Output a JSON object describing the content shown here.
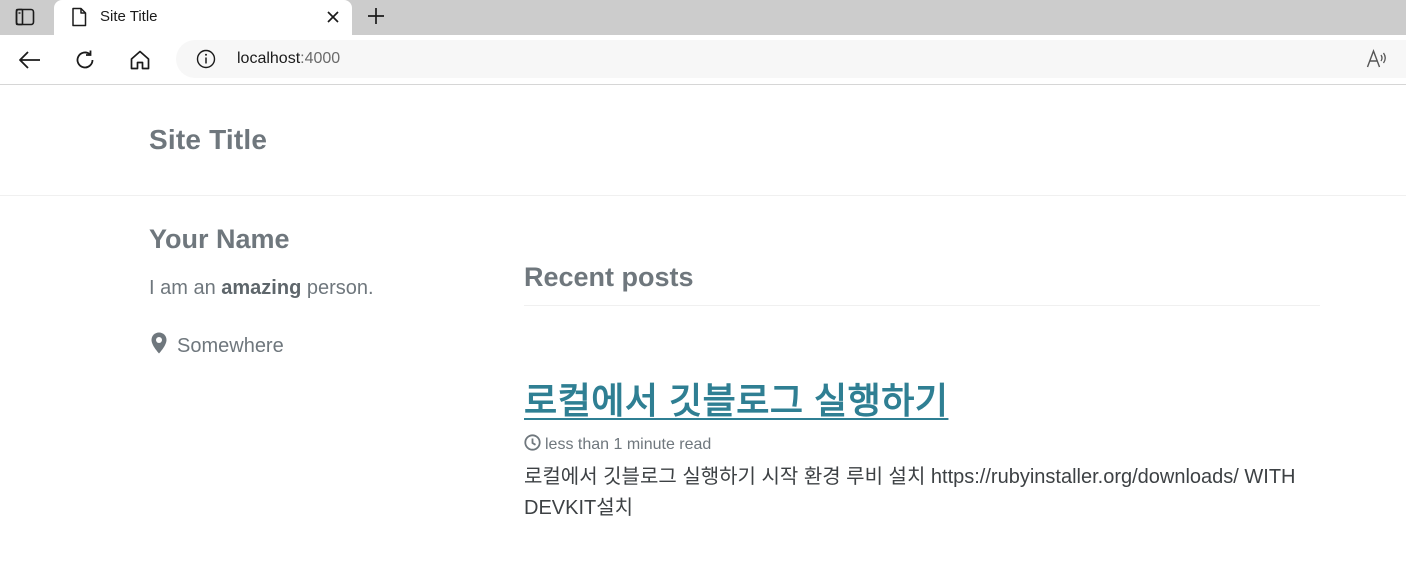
{
  "browser": {
    "tab_title": "Site Title",
    "url_host": "localhost",
    "url_port": ":4000"
  },
  "page": {
    "site_title": "Site Title",
    "author": {
      "name": "Your Name",
      "bio_prefix": "I am an ",
      "bio_bold": "amazing",
      "bio_suffix": " person.",
      "location": "Somewhere"
    },
    "recent_posts_heading": "Recent posts",
    "posts": [
      {
        "title": "로컬에서 깃블로그 실행하기",
        "read_time": "less than 1 minute read",
        "excerpt": "로컬에서 깃블로그 실행하기 시작 환경 루비 설치 https://rubyinstaller.org/downloads/ WITH DEVKIT설치"
      }
    ]
  },
  "colors": {
    "link": "#2f7f93",
    "muted_text": "#6f777d",
    "body_text": "#3d4144",
    "tabbar_bg": "#cccccc"
  },
  "icons": {
    "tab_actions": "tab-actions-icon",
    "favicon": "page-icon",
    "close": "close-icon",
    "new_tab": "plus-icon",
    "back": "back-arrow-icon",
    "refresh": "refresh-icon",
    "home": "home-icon",
    "site_info": "info-icon",
    "read_aloud": "read-aloud-icon",
    "location": "map-marker-icon",
    "read_time": "clock-icon"
  }
}
